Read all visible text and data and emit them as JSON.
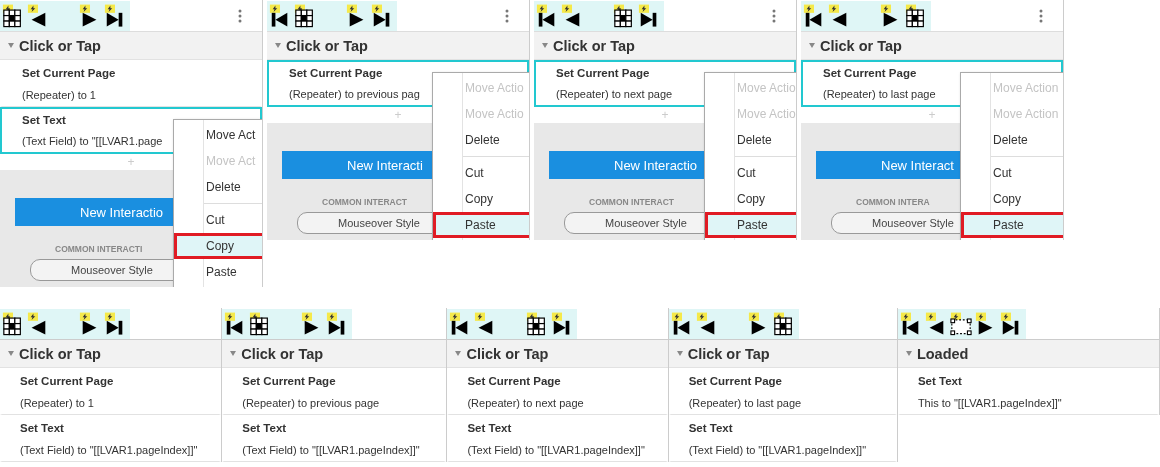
{
  "top_panels": [
    {
      "toolbar": [
        {
          "kind": "grid"
        },
        {
          "kind": "prev"
        },
        {
          "kind": "next"
        },
        {
          "kind": "last"
        }
      ],
      "event": "Click or Tap",
      "actions": [
        {
          "title": "Set Current Page",
          "detail": "(Repeater) to 1",
          "selected": false
        },
        {
          "title": "Set Text",
          "detail": "(Text Field) to \"[[LVAR1.page",
          "selected": true
        }
      ],
      "add": "+",
      "new_button": "New Interactio",
      "common": "COMMON INTERACTI",
      "style_button": "Mouseover Style",
      "menu_groups": [
        [
          {
            "label": "Move Act",
            "disabled": false,
            "selected": false
          },
          {
            "label": "Move Act",
            "disabled": true,
            "selected": false
          },
          {
            "label": "Delete",
            "disabled": false,
            "selected": false
          }
        ],
        [
          {
            "label": "Cut",
            "disabled": false,
            "selected": false
          },
          {
            "label": "Copy",
            "disabled": false,
            "selected": true
          },
          {
            "label": "Paste",
            "disabled": false,
            "selected": false
          }
        ]
      ]
    },
    {
      "toolbar": [
        {
          "kind": "first"
        },
        {
          "kind": "grid"
        },
        {
          "kind": "next"
        },
        {
          "kind": "last"
        }
      ],
      "event": "Click or Tap",
      "actions": [
        {
          "title": "Set Current Page",
          "detail": "(Repeater) to previous pag",
          "selected": true
        }
      ],
      "add": "+",
      "new_button": "New Interacti",
      "common": "COMMON INTERACT",
      "style_button": "Mouseover Style",
      "menu_groups": [
        [
          {
            "label": "Move Actio",
            "disabled": true,
            "selected": false
          },
          {
            "label": "Move Actio",
            "disabled": true,
            "selected": false
          },
          {
            "label": "Delete",
            "disabled": false,
            "selected": false
          }
        ],
        [
          {
            "label": "Cut",
            "disabled": false,
            "selected": false
          },
          {
            "label": "Copy",
            "disabled": false,
            "selected": false
          },
          {
            "label": "Paste",
            "disabled": false,
            "selected": true
          }
        ]
      ]
    },
    {
      "toolbar": [
        {
          "kind": "first"
        },
        {
          "kind": "prev"
        },
        {
          "kind": "grid"
        },
        {
          "kind": "last"
        }
      ],
      "event": "Click or Tap",
      "actions": [
        {
          "title": "Set Current Page",
          "detail": "(Repeater) to next page",
          "selected": true
        }
      ],
      "add": "+",
      "new_button": "New Interactio",
      "common": "COMMON INTERACT",
      "style_button": "Mouseover Style",
      "menu_groups": [
        [
          {
            "label": "Move Actio",
            "disabled": true,
            "selected": false
          },
          {
            "label": "Move Actio",
            "disabled": true,
            "selected": false
          },
          {
            "label": "Delete",
            "disabled": false,
            "selected": false
          }
        ],
        [
          {
            "label": "Cut",
            "disabled": false,
            "selected": false
          },
          {
            "label": "Copy",
            "disabled": false,
            "selected": false
          },
          {
            "label": "Paste",
            "disabled": false,
            "selected": true
          }
        ]
      ]
    },
    {
      "toolbar": [
        {
          "kind": "first"
        },
        {
          "kind": "prev"
        },
        {
          "kind": "next"
        },
        {
          "kind": "grid"
        }
      ],
      "event": "Click or Tap",
      "actions": [
        {
          "title": "Set Current Page",
          "detail": "(Repeater) to last page",
          "selected": true
        }
      ],
      "add": "+",
      "new_button": "New Interact",
      "common": "COMMON INTERA",
      "style_button": "Mouseover Style",
      "menu_groups": [
        [
          {
            "label": "Move Action",
            "disabled": true,
            "selected": false
          },
          {
            "label": "Move Action",
            "disabled": true,
            "selected": false
          },
          {
            "label": "Delete",
            "disabled": false,
            "selected": false
          }
        ],
        [
          {
            "label": "Cut",
            "disabled": false,
            "selected": false
          },
          {
            "label": "Copy",
            "disabled": false,
            "selected": false
          },
          {
            "label": "Paste",
            "disabled": false,
            "selected": true
          }
        ]
      ]
    }
  ],
  "bottom_panels": [
    {
      "toolbar": [
        {
          "kind": "grid"
        },
        {
          "kind": "prev"
        },
        {
          "kind": "next"
        },
        {
          "kind": "last"
        }
      ],
      "event": "Click or Tap",
      "actions": [
        {
          "title": "Set Current Page",
          "detail": "(Repeater) to 1"
        },
        {
          "title": "Set Text",
          "detail": "(Text Field) to \"[[LVAR1.pageIndex]]\""
        }
      ]
    },
    {
      "toolbar": [
        {
          "kind": "first"
        },
        {
          "kind": "grid"
        },
        {
          "kind": "next"
        },
        {
          "kind": "last"
        }
      ],
      "event": "Click or Tap",
      "actions": [
        {
          "title": "Set Current Page",
          "detail": "(Repeater) to previous page"
        },
        {
          "title": "Set Text",
          "detail": "(Text Field) to \"[[LVAR1.pageIndex]]\""
        }
      ]
    },
    {
      "toolbar": [
        {
          "kind": "first"
        },
        {
          "kind": "prev"
        },
        {
          "kind": "grid"
        },
        {
          "kind": "last"
        }
      ],
      "event": "Click or Tap",
      "actions": [
        {
          "title": "Set Current Page",
          "detail": "(Repeater) to next page"
        },
        {
          "title": "Set Text",
          "detail": "(Text Field) to \"[[LVAR1.pageIndex]]\""
        }
      ]
    },
    {
      "toolbar": [
        {
          "kind": "first"
        },
        {
          "kind": "prev"
        },
        {
          "kind": "next"
        },
        {
          "kind": "grid"
        }
      ],
      "event": "Click or Tap",
      "actions": [
        {
          "title": "Set Current Page",
          "detail": "(Repeater) to last page"
        },
        {
          "title": "Set Text",
          "detail": "(Text Field) to \"[[LVAR1.pageIndex]]\""
        }
      ]
    },
    {
      "toolbar": [
        {
          "kind": "first"
        },
        {
          "kind": "prev"
        },
        {
          "kind": "textbox"
        },
        {
          "kind": "next"
        },
        {
          "kind": "last"
        }
      ],
      "event": "Loaded",
      "actions": [
        {
          "title": "Set Text",
          "detail": "This to \"[[LVAR1.pageIndex]]\""
        }
      ]
    }
  ]
}
